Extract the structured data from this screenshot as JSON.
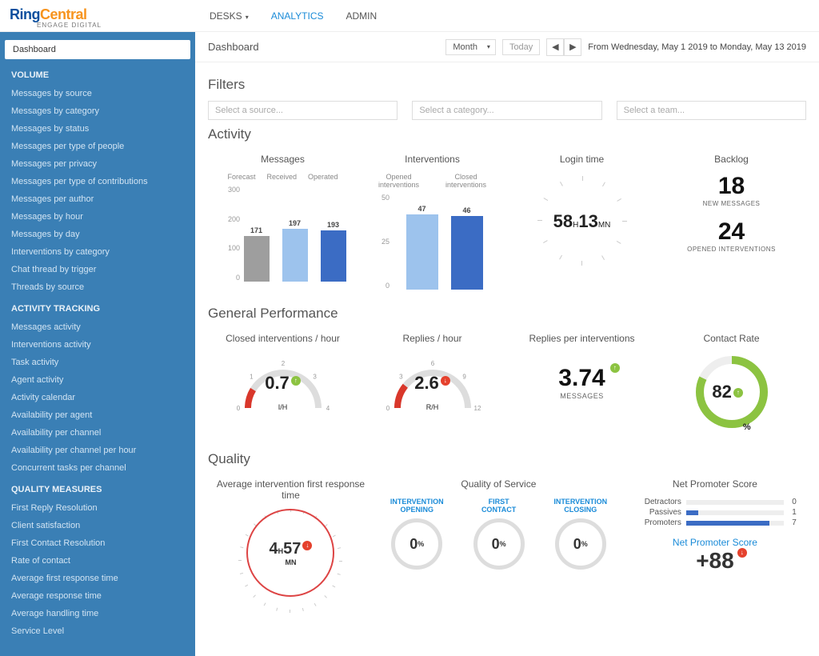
{
  "brand": {
    "part1": "Ring",
    "part2": "Central",
    "sub": "ENGAGE DIGITAL"
  },
  "topnav": {
    "desks": "DESKS",
    "analytics": "ANALYTICS",
    "admin": "ADMIN"
  },
  "header": {
    "title": "Dashboard",
    "period": "Month",
    "today": "Today",
    "range": "From Wednesday, May 1 2019 to Monday, May 13 2019"
  },
  "sidebar": {
    "dashboard": "Dashboard",
    "sections": [
      {
        "title": "VOLUME",
        "items": [
          "Messages by source",
          "Messages by category",
          "Messages by status",
          "Messages per type of people",
          "Messages per privacy",
          "Messages per type of contributions",
          "Messages per author",
          "Messages by hour",
          "Messages by day",
          "Interventions by category",
          "Chat thread by trigger",
          "Threads by source"
        ]
      },
      {
        "title": "ACTIVITY TRACKING",
        "items": [
          "Messages activity",
          "Interventions activity",
          "Task activity",
          "Agent activity",
          "Activity calendar",
          "Availability per agent",
          "Availability per channel",
          "Availability per channel per hour",
          "Concurrent tasks per channel"
        ]
      },
      {
        "title": "QUALITY MEASURES",
        "items": [
          "First Reply Resolution",
          "Client satisfaction",
          "First Contact Resolution",
          "Rate of contact",
          "Average first response time",
          "Average response time",
          "Average handling time",
          "Service Level"
        ]
      }
    ]
  },
  "filters": {
    "title": "Filters",
    "source": "Select a source...",
    "category": "Select a category...",
    "team": "Select a team..."
  },
  "activity": {
    "title": "Activity",
    "messages": {
      "title": "Messages",
      "legend": [
        "Forecast",
        "Received",
        "Operated"
      ],
      "chart_data": {
        "type": "bar",
        "categories": [
          "Forecast",
          "Received",
          "Operated"
        ],
        "values": [
          171,
          197,
          193
        ],
        "ylim": [
          0,
          300
        ],
        "ticks": [
          300,
          200,
          100,
          0
        ]
      }
    },
    "interventions": {
      "title": "Interventions",
      "legend": [
        "Opened interventions",
        "Closed interventions"
      ],
      "chart_data": {
        "type": "bar",
        "categories": [
          "Opened",
          "Closed"
        ],
        "values": [
          47,
          46
        ],
        "ylim": [
          0,
          50
        ],
        "ticks": [
          50,
          25,
          0
        ]
      }
    },
    "login": {
      "title": "Login time",
      "hours": "58",
      "h_unit": "H",
      "mins": "13",
      "m_unit": "MN"
    },
    "backlog": {
      "title": "Backlog",
      "new_msgs_n": "18",
      "new_msgs_l": "NEW MESSAGES",
      "open_int_n": "24",
      "open_int_l": "OPENED INTERVENTIONS"
    }
  },
  "general": {
    "title": "General Performance",
    "closed": {
      "title": "Closed interventions / hour",
      "value": "0.7",
      "unit": "I/H",
      "ticks": [
        "0",
        "1",
        "2",
        "3",
        "4"
      ]
    },
    "replies": {
      "title": "Replies / hour",
      "value": "2.6",
      "unit": "R/H",
      "ticks": [
        "0",
        "3",
        "6",
        "9",
        "12"
      ]
    },
    "rpi": {
      "title": "Replies per interventions",
      "value": "3.74",
      "sub": "MESSAGES"
    },
    "contact": {
      "title": "Contact Rate",
      "value": "82",
      "pct": "%",
      "fill": 0.82
    }
  },
  "quality": {
    "title": "Quality",
    "avg_first": {
      "title": "Average intervention first response time",
      "h": "4",
      "h_unit": "H",
      "m": "57",
      "m_unit": "MN"
    },
    "qos": {
      "title": "Quality of Service",
      "items": [
        {
          "label": "INTERVENTION OPENING",
          "value": "0",
          "pct": "%"
        },
        {
          "label": "FIRST CONTACT",
          "value": "0",
          "pct": "%"
        },
        {
          "label": "INTERVENTION CLOSING",
          "value": "0",
          "pct": "%"
        }
      ]
    },
    "nps": {
      "title": "Net Promoter Score",
      "rows": [
        {
          "label": "Detractors",
          "n": "0",
          "w": 0
        },
        {
          "label": "Passives",
          "n": "1",
          "w": 12
        },
        {
          "label": "Promoters",
          "n": "7",
          "w": 85
        }
      ],
      "score_label": "Net Promoter Score",
      "score": "+88"
    }
  }
}
